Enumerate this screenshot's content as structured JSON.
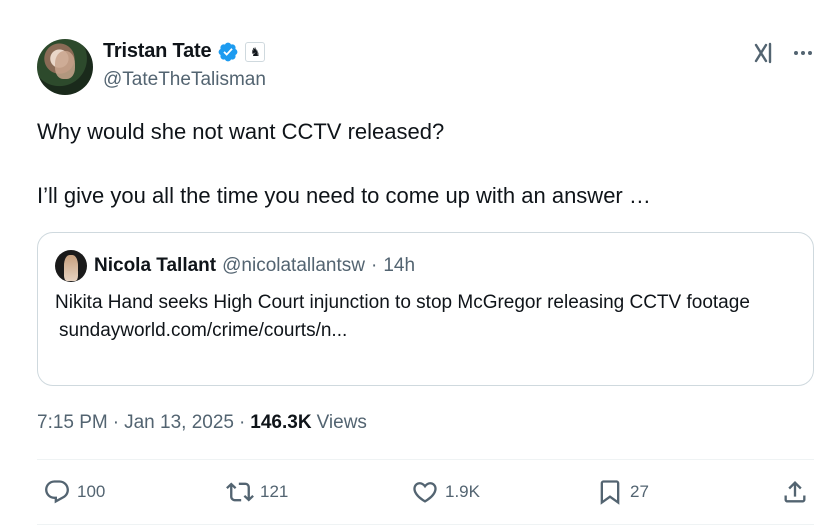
{
  "author": {
    "display_name": "Tristan Tate",
    "handle": "@TateTheTalisman",
    "verified_badge_color": "#1d9bf0",
    "affiliation_icon": "chess-knight-icon"
  },
  "tweet": {
    "lines": [
      "Why would she not want CCTV released?",
      "I’ll give you all the time you need to come up with an answer …"
    ]
  },
  "quote": {
    "display_name": "Nicola Tallant",
    "handle": "@nicolatallantsw",
    "separator": "·",
    "time": "14h",
    "text": "Nikita Hand seeks High Court injunction to stop McGregor releasing CCTV footage",
    "link": "sundayworld.com/crime/courts/n..."
  },
  "meta": {
    "time": "7:15 PM",
    "separator": "·",
    "date": "Jan 13, 2025",
    "separator2": "·",
    "views_count": "146.3K",
    "views_label": "Views"
  },
  "actions": {
    "reply_count": "100",
    "retweet_count": "121",
    "like_count": "1.9K",
    "bookmark_count": "27"
  },
  "colors": {
    "text_primary": "#0f1419",
    "text_secondary": "#536471",
    "border": "#cfd9de",
    "accent": "#1d9bf0"
  }
}
